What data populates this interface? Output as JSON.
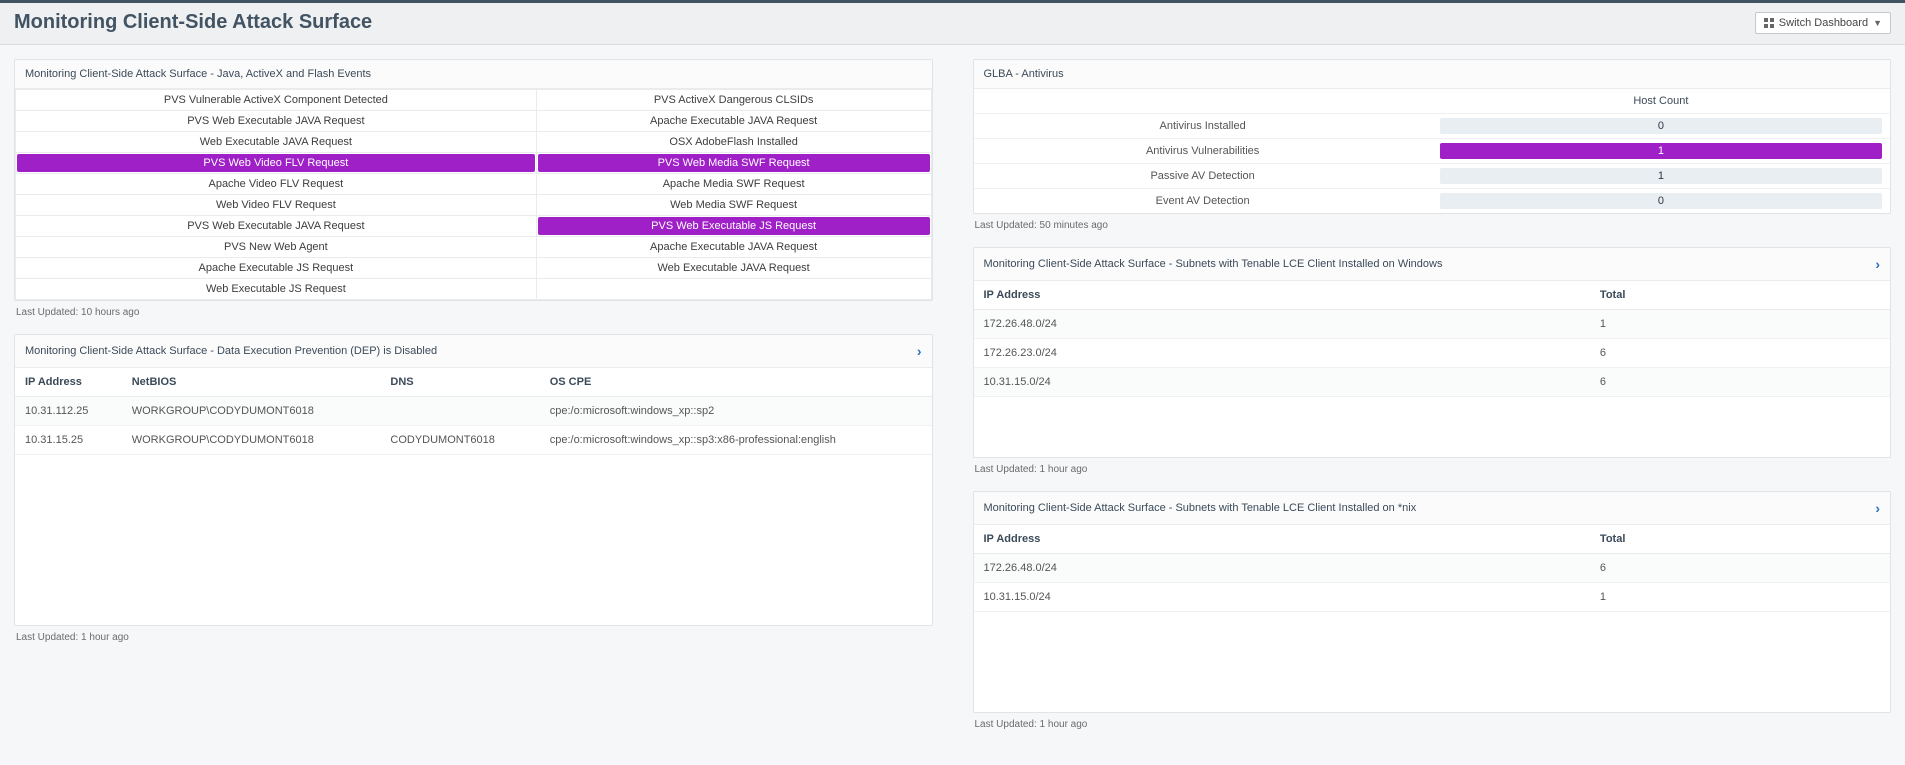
{
  "header": {
    "title": "Monitoring Client-Side Attack Surface",
    "switch_label": "Switch Dashboard"
  },
  "panels": {
    "events": {
      "title": "Monitoring Client-Side Attack Surface - Java, ActiveX and Flash Events",
      "rows": [
        {
          "left": {
            "text": "PVS Vulnerable ActiveX Component Detected",
            "hl": false
          },
          "right": {
            "text": "PVS ActiveX Dangerous CLSIDs",
            "hl": false
          }
        },
        {
          "left": {
            "text": "PVS Web Executable JAVA Request",
            "hl": false
          },
          "right": {
            "text": "Apache Executable JAVA Request",
            "hl": false
          }
        },
        {
          "left": {
            "text": "Web Executable JAVA Request",
            "hl": false
          },
          "right": {
            "text": "OSX AdobeFlash Installed",
            "hl": false
          }
        },
        {
          "left": {
            "text": "PVS Web Video FLV Request",
            "hl": true
          },
          "right": {
            "text": "PVS Web Media SWF Request",
            "hl": true
          }
        },
        {
          "left": {
            "text": "Apache Video FLV Request",
            "hl": false
          },
          "right": {
            "text": "Apache Media SWF Request",
            "hl": false
          }
        },
        {
          "left": {
            "text": "Web Video FLV Request",
            "hl": false
          },
          "right": {
            "text": "Web Media SWF Request",
            "hl": false
          }
        },
        {
          "left": {
            "text": "PVS Web Executable JAVA Request",
            "hl": false
          },
          "right": {
            "text": "PVS Web Executable JS Request",
            "hl": true
          }
        },
        {
          "left": {
            "text": "PVS New Web Agent",
            "hl": false
          },
          "right": {
            "text": "Apache Executable JAVA Request",
            "hl": false
          }
        },
        {
          "left": {
            "text": "Apache Executable JS Request",
            "hl": false
          },
          "right": {
            "text": "Web Executable JAVA Request",
            "hl": false
          }
        },
        {
          "left": {
            "text": "Web Executable JS Request",
            "hl": false
          },
          "right": {
            "text": "",
            "hl": false
          }
        }
      ],
      "last_updated": "Last Updated: 10 hours ago"
    },
    "dep": {
      "title": "Monitoring Client-Side Attack Surface - Data Execution Prevention (DEP) is Disabled",
      "columns": [
        "IP Address",
        "NetBIOS",
        "DNS",
        "OS CPE"
      ],
      "rows": [
        {
          "ip": "10.31.112.25",
          "netbios": "WORKGROUP\\CODYDUMONT6018",
          "dns": "",
          "cpe": "cpe:/o:microsoft:windows_xp::sp2"
        },
        {
          "ip": "10.31.15.25",
          "netbios": "WORKGROUP\\CODYDUMONT6018",
          "dns": "CODYDUMONT6018",
          "cpe": "cpe:/o:microsoft:windows_xp::sp3:x86-professional:english"
        }
      ],
      "last_updated": "Last Updated: 1 hour ago"
    },
    "glba": {
      "title": "GLBA - Antivirus",
      "count_header": "Host Count",
      "rows": [
        {
          "label": "Antivirus Installed",
          "count": "0",
          "hl": false
        },
        {
          "label": "Antivirus Vulnerabilities",
          "count": "1",
          "hl": true
        },
        {
          "label": "Passive AV Detection",
          "count": "1",
          "hl": false
        },
        {
          "label": "Event AV Detection",
          "count": "0",
          "hl": false
        }
      ],
      "last_updated": "Last Updated: 50 minutes ago"
    },
    "win": {
      "title": "Monitoring Client-Side Attack Surface - Subnets with Tenable LCE Client Installed on Windows",
      "columns": [
        "IP Address",
        "Total"
      ],
      "rows": [
        {
          "ip": "172.26.48.0/24",
          "total": "1"
        },
        {
          "ip": "172.26.23.0/24",
          "total": "6"
        },
        {
          "ip": "10.31.15.0/24",
          "total": "6"
        }
      ],
      "last_updated": "Last Updated: 1 hour ago"
    },
    "nix": {
      "title": "Monitoring Client-Side Attack Surface - Subnets with Tenable LCE Client Installed on *nix",
      "columns": [
        "IP Address",
        "Total"
      ],
      "rows": [
        {
          "ip": "172.26.48.0/24",
          "total": "6"
        },
        {
          "ip": "10.31.15.0/24",
          "total": "1"
        }
      ],
      "last_updated": "Last Updated: 1 hour ago"
    }
  }
}
